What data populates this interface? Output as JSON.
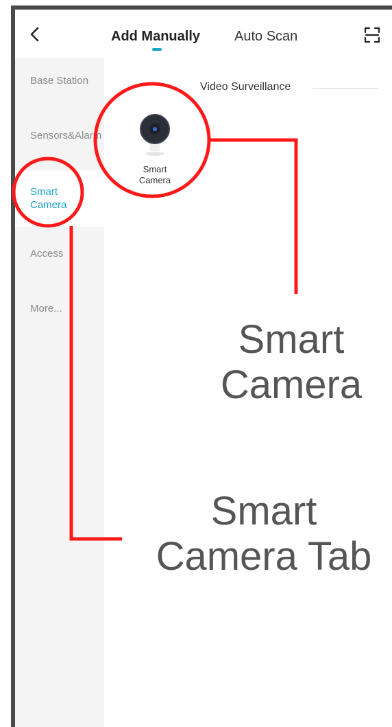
{
  "header": {
    "tab_manual": "Add Manually",
    "tab_scan": "Auto Scan"
  },
  "sidebar": {
    "items": [
      {
        "label": "Base Station"
      },
      {
        "label": "Sensors&Alarm"
      },
      {
        "label": "Smart Camera"
      },
      {
        "label": "Access"
      },
      {
        "label": "More..."
      }
    ]
  },
  "main": {
    "section_title": "Video Surveillance",
    "device_label": "Smart Camera"
  },
  "annotations": {
    "camera_label": "Smart Camera",
    "tab_label": "Smart Camera Tab"
  },
  "colors": {
    "accent": "#1ba6c9",
    "annotation": "#ff1a1a"
  }
}
